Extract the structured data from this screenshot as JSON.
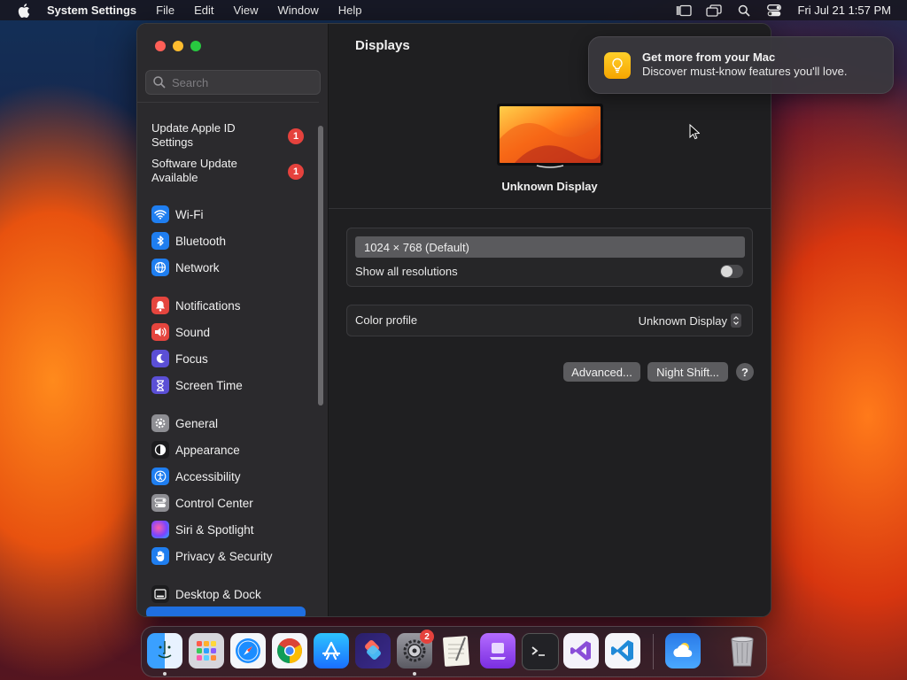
{
  "menubar": {
    "app_name": "System Settings",
    "items": [
      "File",
      "Edit",
      "View",
      "Window",
      "Help"
    ],
    "clock": "Fri Jul 21  1:57 PM"
  },
  "sidebar": {
    "search_placeholder": "Search",
    "alerts": [
      {
        "label_line1": "Update Apple ID",
        "label_line2": "Settings",
        "badge": "1"
      },
      {
        "label_line1": "Software Update",
        "label_line2": "Available",
        "badge": "1"
      }
    ],
    "items": [
      {
        "label": "Wi-Fi",
        "icon": "wifi-icon",
        "color": "#1f7ef0"
      },
      {
        "label": "Bluetooth",
        "icon": "bluetooth-icon",
        "color": "#1f7ef0"
      },
      {
        "label": "Network",
        "icon": "network-icon",
        "color": "#1f7ef0"
      },
      {
        "label": "Notifications",
        "icon": "notifications-icon",
        "color": "#e5453e"
      },
      {
        "label": "Sound",
        "icon": "sound-icon",
        "color": "#e5453e"
      },
      {
        "label": "Focus",
        "icon": "focus-icon",
        "color": "#5b4fd6"
      },
      {
        "label": "Screen Time",
        "icon": "screen-time-icon",
        "color": "#5b4fd6"
      },
      {
        "label": "General",
        "icon": "general-icon",
        "color": "#8e8e93"
      },
      {
        "label": "Appearance",
        "icon": "appearance-icon",
        "color": "#1c1c1e"
      },
      {
        "label": "Accessibility",
        "icon": "accessibility-icon",
        "color": "#1f7ef0"
      },
      {
        "label": "Control Center",
        "icon": "control-center-icon",
        "color": "#8e8e93"
      },
      {
        "label": "Siri & Spotlight",
        "icon": "siri-icon",
        "color": "#b04fd6"
      },
      {
        "label": "Privacy & Security",
        "icon": "privacy-icon",
        "color": "#1f7ef0"
      },
      {
        "label": "Desktop & Dock",
        "icon": "desktop-dock-icon",
        "color": "#1c1c1e"
      }
    ]
  },
  "main": {
    "title": "Displays",
    "display_name": "Unknown Display",
    "resolution": "1024 × 768 (Default)",
    "show_all_label": "Show all resolutions",
    "show_all_on": false,
    "color_profile_label": "Color profile",
    "color_profile_value": "Unknown Display",
    "advanced_button": "Advanced...",
    "night_shift_button": "Night Shift...",
    "help_button": "?"
  },
  "notification": {
    "title": "Get more from your Mac",
    "body": "Discover must-know features you'll love."
  },
  "dock": {
    "apps": [
      "finder-icon",
      "launchpad-icon",
      "safari-icon",
      "chrome-icon",
      "app-store-icon",
      "shortcuts-icon",
      "system-settings-icon",
      "textedit-icon",
      "podcasts-icon",
      "terminal-icon",
      "visual-studio-icon",
      "vscode-icon",
      "weather-icon",
      "trash-icon"
    ],
    "settings_badge": "2"
  }
}
